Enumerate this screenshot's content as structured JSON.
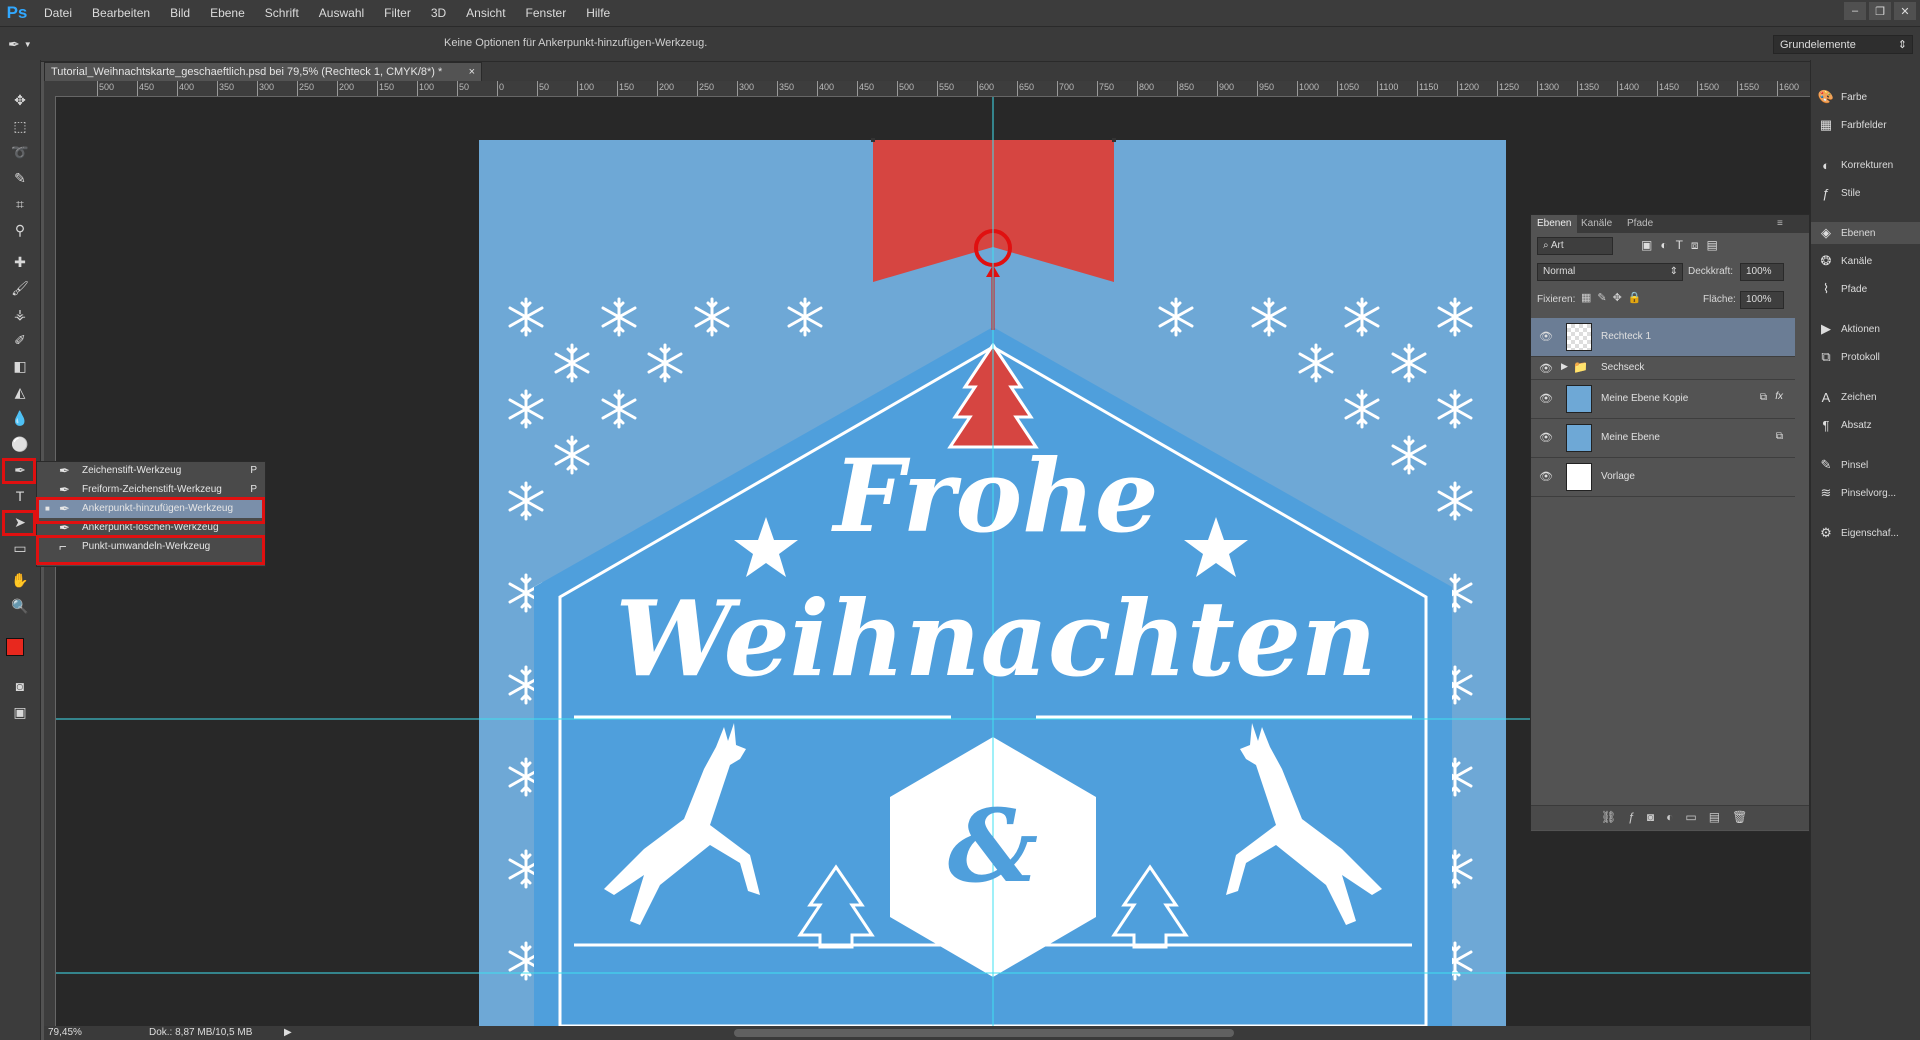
{
  "app": {
    "logo": "Ps",
    "menu": [
      "Datei",
      "Bearbeiten",
      "Bild",
      "Ebene",
      "Schrift",
      "Auswahl",
      "Filter",
      "3D",
      "Ansicht",
      "Fenster",
      "Hilfe"
    ],
    "window_controls": [
      "–",
      "❐",
      "✕"
    ]
  },
  "options_bar": {
    "tool_glyph": "✒",
    "message": "Keine Optionen für Ankerpunkt-hinzufügen-Werkzeug.",
    "workspace": "Grundelemente"
  },
  "document": {
    "tab_title": "Tutorial_Weihnachtskarte_geschaeftlich.psd bei 79,5% (Rechteck 1, CMYK/8*) *",
    "close_glyph": "×"
  },
  "ruler": {
    "h_labels": [
      "500",
      "450",
      "400",
      "350",
      "300",
      "250",
      "200",
      "150",
      "100",
      "50",
      "0",
      "50",
      "100",
      "150",
      "200",
      "250",
      "300",
      "350",
      "400",
      "450",
      "500",
      "550",
      "600",
      "650",
      "700",
      "750",
      "800",
      "850",
      "900",
      "950",
      "1000",
      "1050",
      "1100",
      "1150",
      "1200",
      "1250",
      "1300",
      "1350",
      "1400",
      "1450",
      "1500",
      "1550",
      "1600"
    ]
  },
  "flyout": {
    "items": [
      {
        "label": "Zeichenstift-Werkzeug",
        "shortcut": "P",
        "glyph": "✒"
      },
      {
        "label": "Freiform-Zeichenstift-Werkzeug",
        "shortcut": "P",
        "glyph": "✒"
      },
      {
        "label": "Ankerpunkt-hinzufügen-Werkzeug",
        "shortcut": "",
        "glyph": "✒"
      },
      {
        "label": "Ankerpunkt-löschen-Werkzeug",
        "shortcut": "",
        "glyph": "✒"
      },
      {
        "label": "Punkt-umwandeln-Werkzeug",
        "shortcut": "",
        "glyph": "⌐"
      }
    ]
  },
  "card": {
    "line1": "Frohe",
    "line2": "Weihnachten",
    "ampersand": "&",
    "colors": {
      "bg": "#6ea8d6",
      "shield": "#4f9fdc",
      "ribbon": "#d64541",
      "white": "#ffffff"
    }
  },
  "dock": {
    "items": [
      "Farbe",
      "Farbfelder",
      "Korrekturen",
      "Stile",
      "Ebenen",
      "Kanäle",
      "Pfade",
      "Aktionen",
      "Protokoll",
      "Zeichen",
      "Absatz",
      "Pinsel",
      "Pinselvorg...",
      "Eigenschaf..."
    ]
  },
  "layers_panel": {
    "tabs": [
      "Ebenen",
      "Kanäle",
      "Pfade"
    ],
    "filter": "Art",
    "blend_mode": "Normal",
    "opacity_label": "Deckkraft:",
    "opacity_value": "100%",
    "lock_label": "Fixieren:",
    "fill_label": "Fläche:",
    "fill_value": "100%",
    "layers": [
      {
        "name": "Rechteck 1",
        "selected": true
      },
      {
        "name": "Sechseck",
        "group": true
      },
      {
        "name": "Meine Ebene Kopie",
        "fx": "fx"
      },
      {
        "name": "Meine Ebene"
      },
      {
        "name": "Vorlage"
      }
    ]
  },
  "status": {
    "zoom": "79,45%",
    "doc_info": "Dok.: 8,87 MB/10,5 MB"
  }
}
